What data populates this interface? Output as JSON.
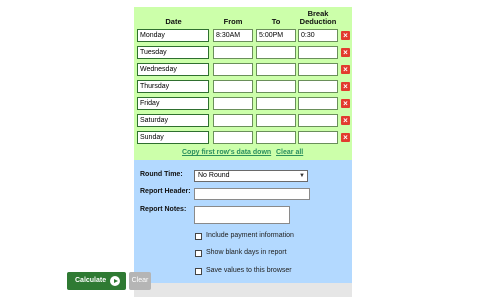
{
  "headers": {
    "date": "Date",
    "from": "From",
    "to": "To",
    "break_line1": "Break",
    "break_line2": "Deduction"
  },
  "rows": [
    {
      "day": "Monday",
      "from": "8:30AM",
      "to": "5:00PM",
      "break": "0:30"
    },
    {
      "day": "Tuesday",
      "from": "",
      "to": "",
      "break": ""
    },
    {
      "day": "Wednesday",
      "from": "",
      "to": "",
      "break": ""
    },
    {
      "day": "Thursday",
      "from": "",
      "to": "",
      "break": ""
    },
    {
      "day": "Friday",
      "from": "",
      "to": "",
      "break": ""
    },
    {
      "day": "Saturday",
      "from": "",
      "to": "",
      "break": ""
    },
    {
      "day": "Sunday",
      "from": "",
      "to": "",
      "break": ""
    }
  ],
  "delete_glyph": "×",
  "links": {
    "copy": "Copy first row's data down",
    "clear_all": "Clear all"
  },
  "options": {
    "round_time_label": "Round Time:",
    "round_time_value": "No Round",
    "report_header_label": "Report Header:",
    "report_notes_label": "Report Notes:",
    "include_payment": "Include payment information",
    "show_blank_days": "Show blank days in report",
    "save_values": "Save values to this browser"
  },
  "buttons": {
    "calculate": "Calculate",
    "clear": "Clear"
  },
  "colors": {
    "top_bg": "#ccffaa",
    "bottom_bg": "#b3d9ff",
    "accent_green": "#2f7a33",
    "delete_red": "#e23b2e"
  }
}
